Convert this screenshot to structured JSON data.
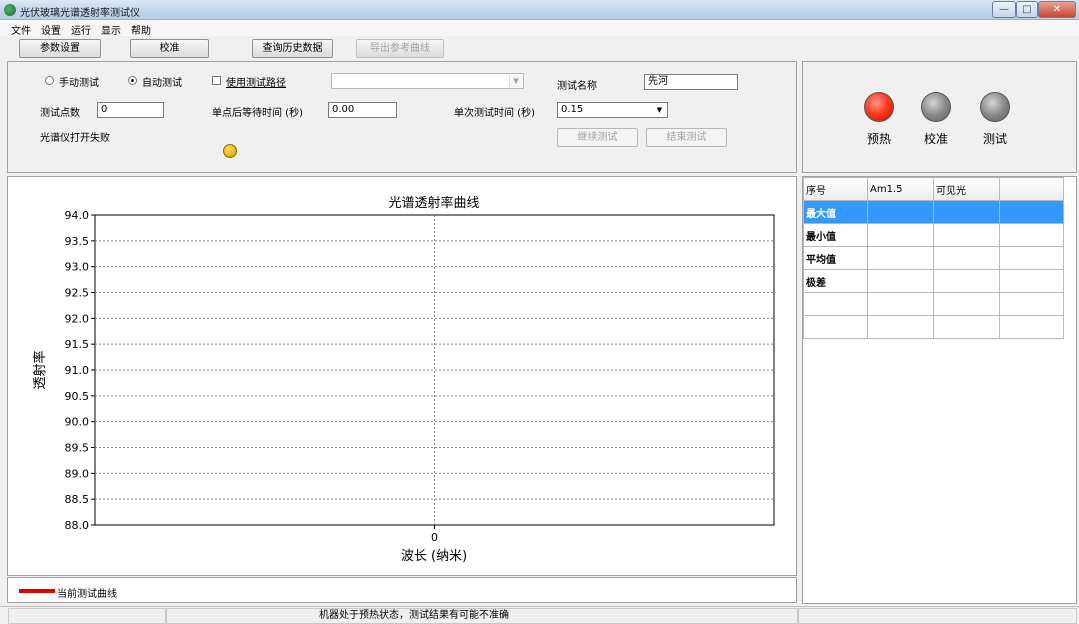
{
  "window": {
    "title": "光伏玻璃光谱透射率测试仪",
    "min": "—",
    "max": "□",
    "close": "✕"
  },
  "menu": [
    "文件",
    "设置",
    "运行",
    "显示",
    "帮助"
  ],
  "toolbar": {
    "params": "参数设置",
    "calibrate": "校准",
    "history": "查询历史数据",
    "export": "导出参考曲线"
  },
  "controls": {
    "manual_test": "手动测试",
    "auto_test": "自动测试",
    "selected_mode": "auto",
    "use_path": "使用测试路径",
    "use_path_checked": false,
    "path_value": "",
    "test_name_label": "测试名称",
    "test_name_value": "先河",
    "points_label": "测试点数",
    "points_value": "0",
    "wait_label": "单点后等待时间 (秒)",
    "wait_value": "0.00",
    "single_time_label": "单次测试时间 (秒)",
    "single_time_value": "0.15",
    "spectrometer_status": "光谱仪打开失败",
    "continue_btn": "继续测试",
    "end_btn": "结束测试"
  },
  "lamps": [
    {
      "label": "预热",
      "color": "red"
    },
    {
      "label": "校准",
      "color": "gray"
    },
    {
      "label": "测试",
      "color": "gray"
    }
  ],
  "chart_data": {
    "type": "line",
    "title": "光谱透射率曲线",
    "xlabel": "波长 (纳米)",
    "ylabel": "透射率",
    "x_ticks": [
      "0"
    ],
    "y_ticks": [
      "94.0",
      "93.5",
      "93.0",
      "92.5",
      "92.0",
      "91.5",
      "91.0",
      "90.5",
      "90.0",
      "89.5",
      "89.0",
      "88.5",
      "88.0"
    ],
    "ylim": [
      88.0,
      94.0
    ],
    "grid": true,
    "series": [
      {
        "name": "当前测试曲线",
        "color": "#e00000",
        "values": []
      }
    ]
  },
  "legend": {
    "label": "当前测试曲线"
  },
  "table": {
    "headers": [
      "序号",
      "Am1.5",
      "可见光",
      ""
    ],
    "rows": [
      [
        "最大值",
        "",
        "",
        ""
      ],
      [
        "最小值",
        "",
        "",
        ""
      ],
      [
        "平均值",
        "",
        "",
        ""
      ],
      [
        "极差",
        "",
        "",
        ""
      ],
      [
        "",
        "",
        "",
        ""
      ],
      [
        "",
        "",
        "",
        ""
      ]
    ],
    "selected_row": 0
  },
  "statusbar": {
    "message": "机器处于预热状态，测试结果有可能不准确"
  }
}
